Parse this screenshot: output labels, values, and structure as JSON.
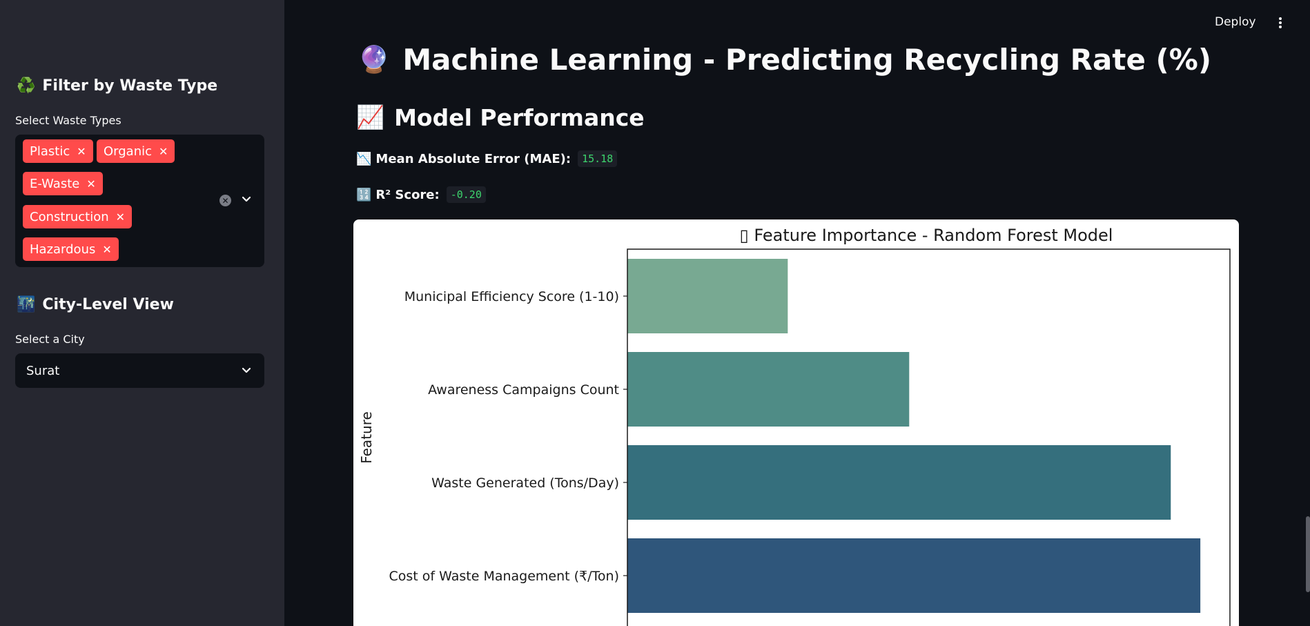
{
  "sidebar": {
    "waste_filter": {
      "icon": "recycle-icon",
      "emoji": "♻️",
      "title": "Filter by Waste Type",
      "label": "Select Waste Types",
      "selected": [
        "Plastic",
        "Organic",
        "E-Waste",
        "Construction",
        "Hazardous"
      ]
    },
    "city_view": {
      "icon": "city-icon",
      "emoji": "🌃",
      "title": "City-Level View",
      "label": "Select a City",
      "selected": "Surat"
    }
  },
  "header": {
    "deploy_label": "Deploy",
    "menu_icon": "kebab-menu-icon"
  },
  "main": {
    "title_emoji": "🔮",
    "title": "Machine Learning - Predicting Recycling Rate (%)",
    "section_emoji": "📈",
    "section_title": "Model Performance",
    "metrics": [
      {
        "icon": "chart-decreasing-icon",
        "emoji": "📉",
        "label": "Mean Absolute Error (MAE):",
        "value": "15.18"
      },
      {
        "icon": "numbers-icon",
        "emoji": "🔢",
        "label": "R² Score:",
        "value": "-0.20"
      }
    ]
  },
  "chart_data": {
    "type": "bar",
    "orientation": "horizontal",
    "title": "▯ Feature Importance - Random Forest Model",
    "ylabel": "Feature",
    "xlabel": "",
    "categories": [
      "Municipal Efficiency Score (1-10)",
      "Awareness Campaigns Count",
      "Waste Generated (Tons/Day)",
      "Cost of Waste Management (₹/Ton)"
    ],
    "values": [
      0.103,
      0.181,
      0.349,
      0.368
    ],
    "xlim": [
      0,
      0.387
    ],
    "xticks": [
      0,
      0.05,
      0.1,
      0.15,
      0.2,
      0.25,
      0.3,
      0.35
    ],
    "colors": [
      "#78a992",
      "#4f8c86",
      "#356f7d",
      "#2f567b"
    ],
    "grid": false
  }
}
